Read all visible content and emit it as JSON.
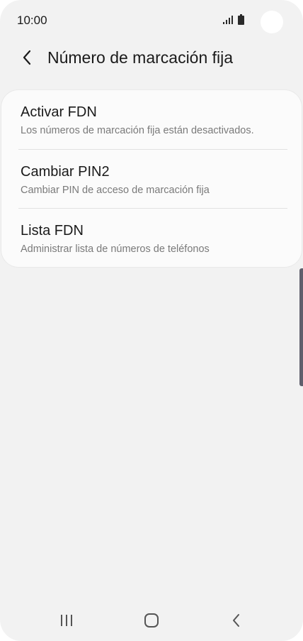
{
  "status_bar": {
    "time": "10:00",
    "icons": [
      "signal-icon",
      "battery-icon"
    ]
  },
  "app_bar": {
    "back_icon": "chevron-left-icon",
    "title": "Número de marcación fija"
  },
  "settings": {
    "items": [
      {
        "title": "Activar FDN",
        "subtitle": "Los números de marcación fija están desactivados."
      },
      {
        "title": "Cambiar PIN2",
        "subtitle": "Cambiar PIN de acceso de marcación fija"
      },
      {
        "title": "Lista FDN",
        "subtitle": "Administrar lista de números de teléfonos"
      }
    ]
  },
  "nav_bar": {
    "icons": [
      "recent-apps-icon",
      "home-icon",
      "back-icon"
    ]
  },
  "colors": {
    "background": "#f2f2f2",
    "card": "#fbfbfb",
    "text_primary": "#1a1a1a",
    "text_secondary": "#7a7a7a",
    "scroll_indicator": "#5f5f6c"
  }
}
